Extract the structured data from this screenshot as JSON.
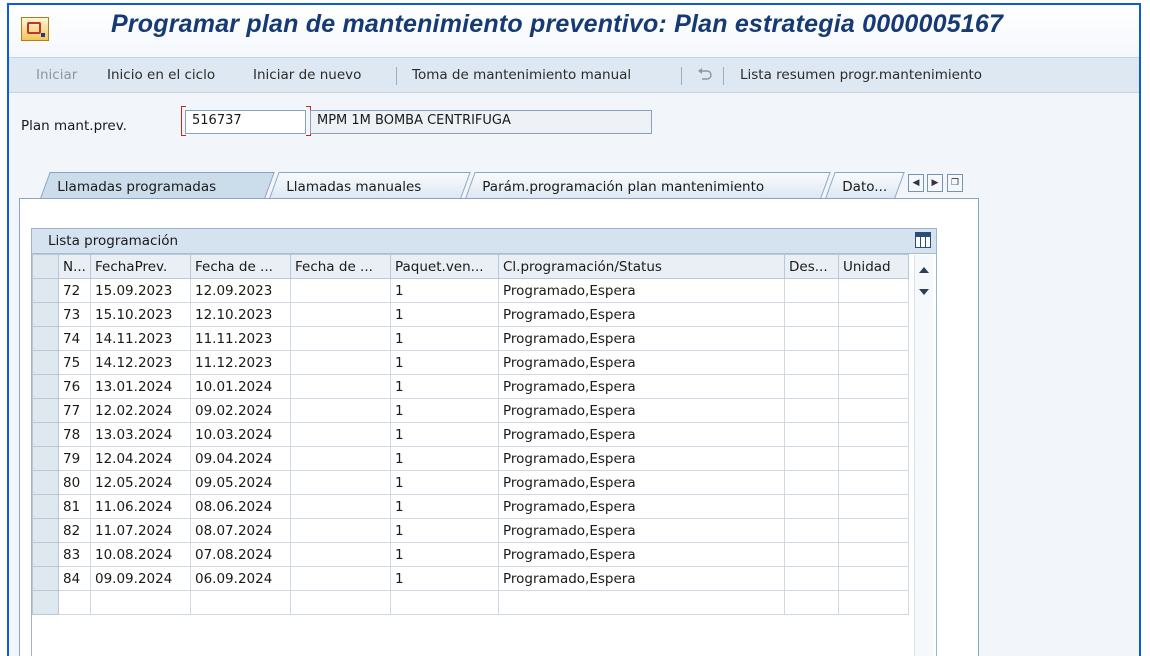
{
  "window": {
    "title": "Programar plan de mantenimiento preventivo: Plan estrategia 0000005167"
  },
  "toolbar": {
    "start": "Iniciar",
    "start_in_cycle": "Inicio en el ciclo",
    "restart": "Iniciar de nuevo",
    "manual_call": "Toma de mantenimiento manual",
    "summary_list": "Lista resumen progr.mantenimiento"
  },
  "form": {
    "plan_label": "Plan mant.prev.",
    "plan_value": "516737",
    "plan_description": "MPM 1M BOMBA CENTRIFUGA"
  },
  "tabs": [
    {
      "label": "Llamadas programadas",
      "active": true
    },
    {
      "label": "Llamadas manuales",
      "active": false
    },
    {
      "label": "Parám.programación plan mantenimiento",
      "active": false
    },
    {
      "label": "Dato...",
      "active": false
    }
  ],
  "grid": {
    "title": "Lista programación",
    "columns": [
      "N...",
      "FechaPrev.",
      "Fecha de ...",
      "Fecha de ...",
      "Paquet.ven...",
      "Cl.programación/Status",
      "Des...",
      "Unidad"
    ],
    "rows": [
      [
        "72",
        "15.09.2023",
        "12.09.2023",
        "",
        "1",
        "Programado,Espera",
        "",
        ""
      ],
      [
        "73",
        "15.10.2023",
        "12.10.2023",
        "",
        "1",
        "Programado,Espera",
        "",
        ""
      ],
      [
        "74",
        "14.11.2023",
        "11.11.2023",
        "",
        "1",
        "Programado,Espera",
        "",
        ""
      ],
      [
        "75",
        "14.12.2023",
        "11.12.2023",
        "",
        "1",
        "Programado,Espera",
        "",
        ""
      ],
      [
        "76",
        "13.01.2024",
        "10.01.2024",
        "",
        "1",
        "Programado,Espera",
        "",
        ""
      ],
      [
        "77",
        "12.02.2024",
        "09.02.2024",
        "",
        "1",
        "Programado,Espera",
        "",
        ""
      ],
      [
        "78",
        "13.03.2024",
        "10.03.2024",
        "",
        "1",
        "Programado,Espera",
        "",
        ""
      ],
      [
        "79",
        "12.04.2024",
        "09.04.2024",
        "",
        "1",
        "Programado,Espera",
        "",
        ""
      ],
      [
        "80",
        "12.05.2024",
        "09.05.2024",
        "",
        "1",
        "Programado,Espera",
        "",
        ""
      ],
      [
        "81",
        "11.06.2024",
        "08.06.2024",
        "",
        "1",
        "Programado,Espera",
        "",
        ""
      ],
      [
        "82",
        "11.07.2024",
        "08.07.2024",
        "",
        "1",
        "Programado,Espera",
        "",
        ""
      ],
      [
        "83",
        "10.08.2024",
        "07.08.2024",
        "",
        "1",
        "Programado,Espera",
        "",
        ""
      ],
      [
        "84",
        "09.09.2024",
        "06.09.2024",
        "",
        "1",
        "Programado,Espera",
        "",
        ""
      ],
      [
        "",
        "",
        "",
        "",
        "",
        "",
        "",
        ""
      ]
    ]
  },
  "icons": {
    "app": "sap-transaction-icon",
    "undo": "undo-icon",
    "tab_prev": "chevron-left-icon",
    "tab_next": "chevron-right-icon",
    "tab_list": "tab-list-icon",
    "layout": "table-settings-icon",
    "scroll_up": "arrow-up-icon",
    "scroll_down": "arrow-down-icon"
  },
  "colors": {
    "frame_border": "#0b5cd6",
    "title_text": "#163a73",
    "toolbar_bg": "#dde8f2",
    "required_marker": "#c2281e"
  }
}
